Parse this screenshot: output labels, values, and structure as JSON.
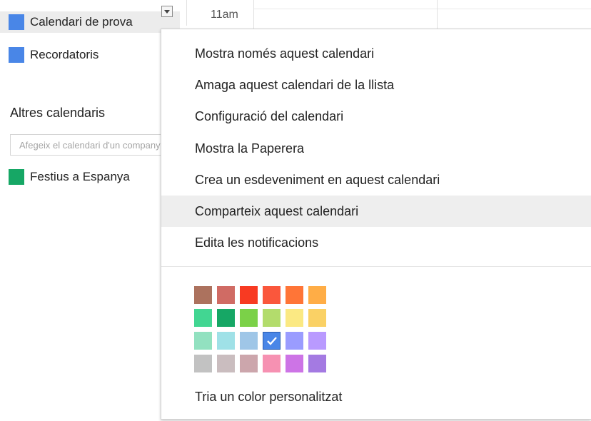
{
  "sidebar": {
    "my_calendars": [
      {
        "label": "Calendari de prova",
        "color": "#4986e7",
        "active": true
      },
      {
        "label": "Recordatoris",
        "color": "#4986e7",
        "active": false
      }
    ],
    "other_calendars_title": "Altres calendaris",
    "add_calendar_placeholder": "Afegeix el calendari d'un company",
    "other_calendars": [
      {
        "label": "Festius a Espanya",
        "color": "#16a765"
      }
    ]
  },
  "grid": {
    "time_label": "11am"
  },
  "menu": {
    "items": [
      {
        "label": "Mostra només aquest calendari"
      },
      {
        "label": "Amaga aquest calendari de la llista"
      },
      {
        "label": "Configuració del calendari"
      },
      {
        "label": "Mostra la Paperera"
      },
      {
        "label": "Crea un esdeveniment en aquest calendari"
      },
      {
        "label": "Comparteix aquest calendari",
        "highlighted": true
      },
      {
        "label": "Edita les notificacions"
      }
    ],
    "palette": [
      [
        "#ac725e",
        "#d06b64",
        "#f83a22",
        "#fa573c",
        "#ff7537",
        "#ffad46"
      ],
      [
        "#42d692",
        "#16a765",
        "#7bd148",
        "#b3dc6c",
        "#fbe983",
        "#fad165"
      ],
      [
        "#92e1c0",
        "#9fe1e7",
        "#9fc6e7",
        "#4986e7",
        "#9a9cff",
        "#b99aff"
      ],
      [
        "#c2c2c2",
        "#cabdbf",
        "#cca6ac",
        "#f691b2",
        "#cd74e6",
        "#a47ae2"
      ]
    ],
    "selected_color": "#4986e7",
    "custom_color_label": "Tria un color personalitzat"
  }
}
